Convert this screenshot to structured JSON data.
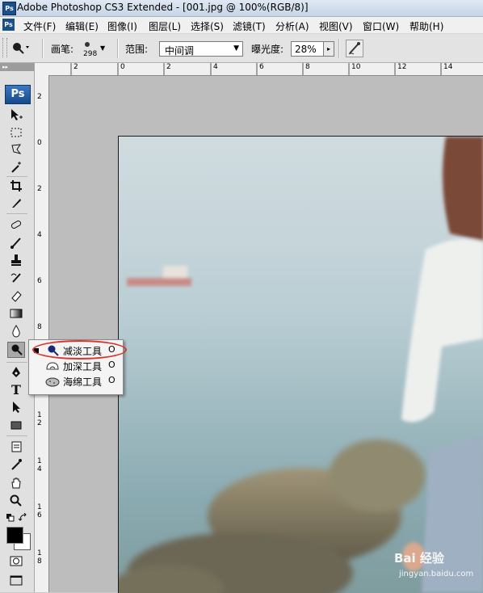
{
  "window": {
    "title": "Adobe Photoshop CS3 Extended - [001.jpg @ 100%(RGB/8)]",
    "app_badge": "Ps"
  },
  "menu": [
    {
      "label": "文件(F)"
    },
    {
      "label": "编辑(E)"
    },
    {
      "label": "图像(I)"
    },
    {
      "label": "图层(L)"
    },
    {
      "label": "选择(S)"
    },
    {
      "label": "滤镜(T)"
    },
    {
      "label": "分析(A)"
    },
    {
      "label": "视图(V)"
    },
    {
      "label": "窗口(W)"
    },
    {
      "label": "帮助(H)"
    }
  ],
  "options": {
    "brush_label": "画笔:",
    "brush_size": "298",
    "range_label": "范围:",
    "range_value": "中间调",
    "exposure_label": "曝光度:",
    "exposure_value": "28%"
  },
  "toolbox": {
    "logo": "Ps",
    "collapse": "▸▸"
  },
  "ruler": {
    "top_labels": [
      "2",
      "0",
      "2",
      "4",
      "6",
      "8",
      "10",
      "12",
      "14"
    ],
    "left_labels": [
      "2",
      "0",
      "2",
      "4",
      "6",
      "8",
      "1",
      "2",
      "1",
      "4",
      "1",
      "6",
      "1",
      "8"
    ]
  },
  "flyout": {
    "items": [
      {
        "label": "减淡工具",
        "key": "O",
        "icon": "dodge-icon",
        "selected": true
      },
      {
        "label": "加深工具",
        "key": "O",
        "icon": "burn-icon",
        "selected": false
      },
      {
        "label": "海绵工具",
        "key": "O",
        "icon": "sponge-icon",
        "selected": false
      }
    ]
  },
  "watermark": {
    "logo": "Bai  经验",
    "url": "jingyan.baidu.com"
  },
  "colors": {
    "highlight": "#d9362e",
    "ps_blue": "#1b4f8c"
  }
}
